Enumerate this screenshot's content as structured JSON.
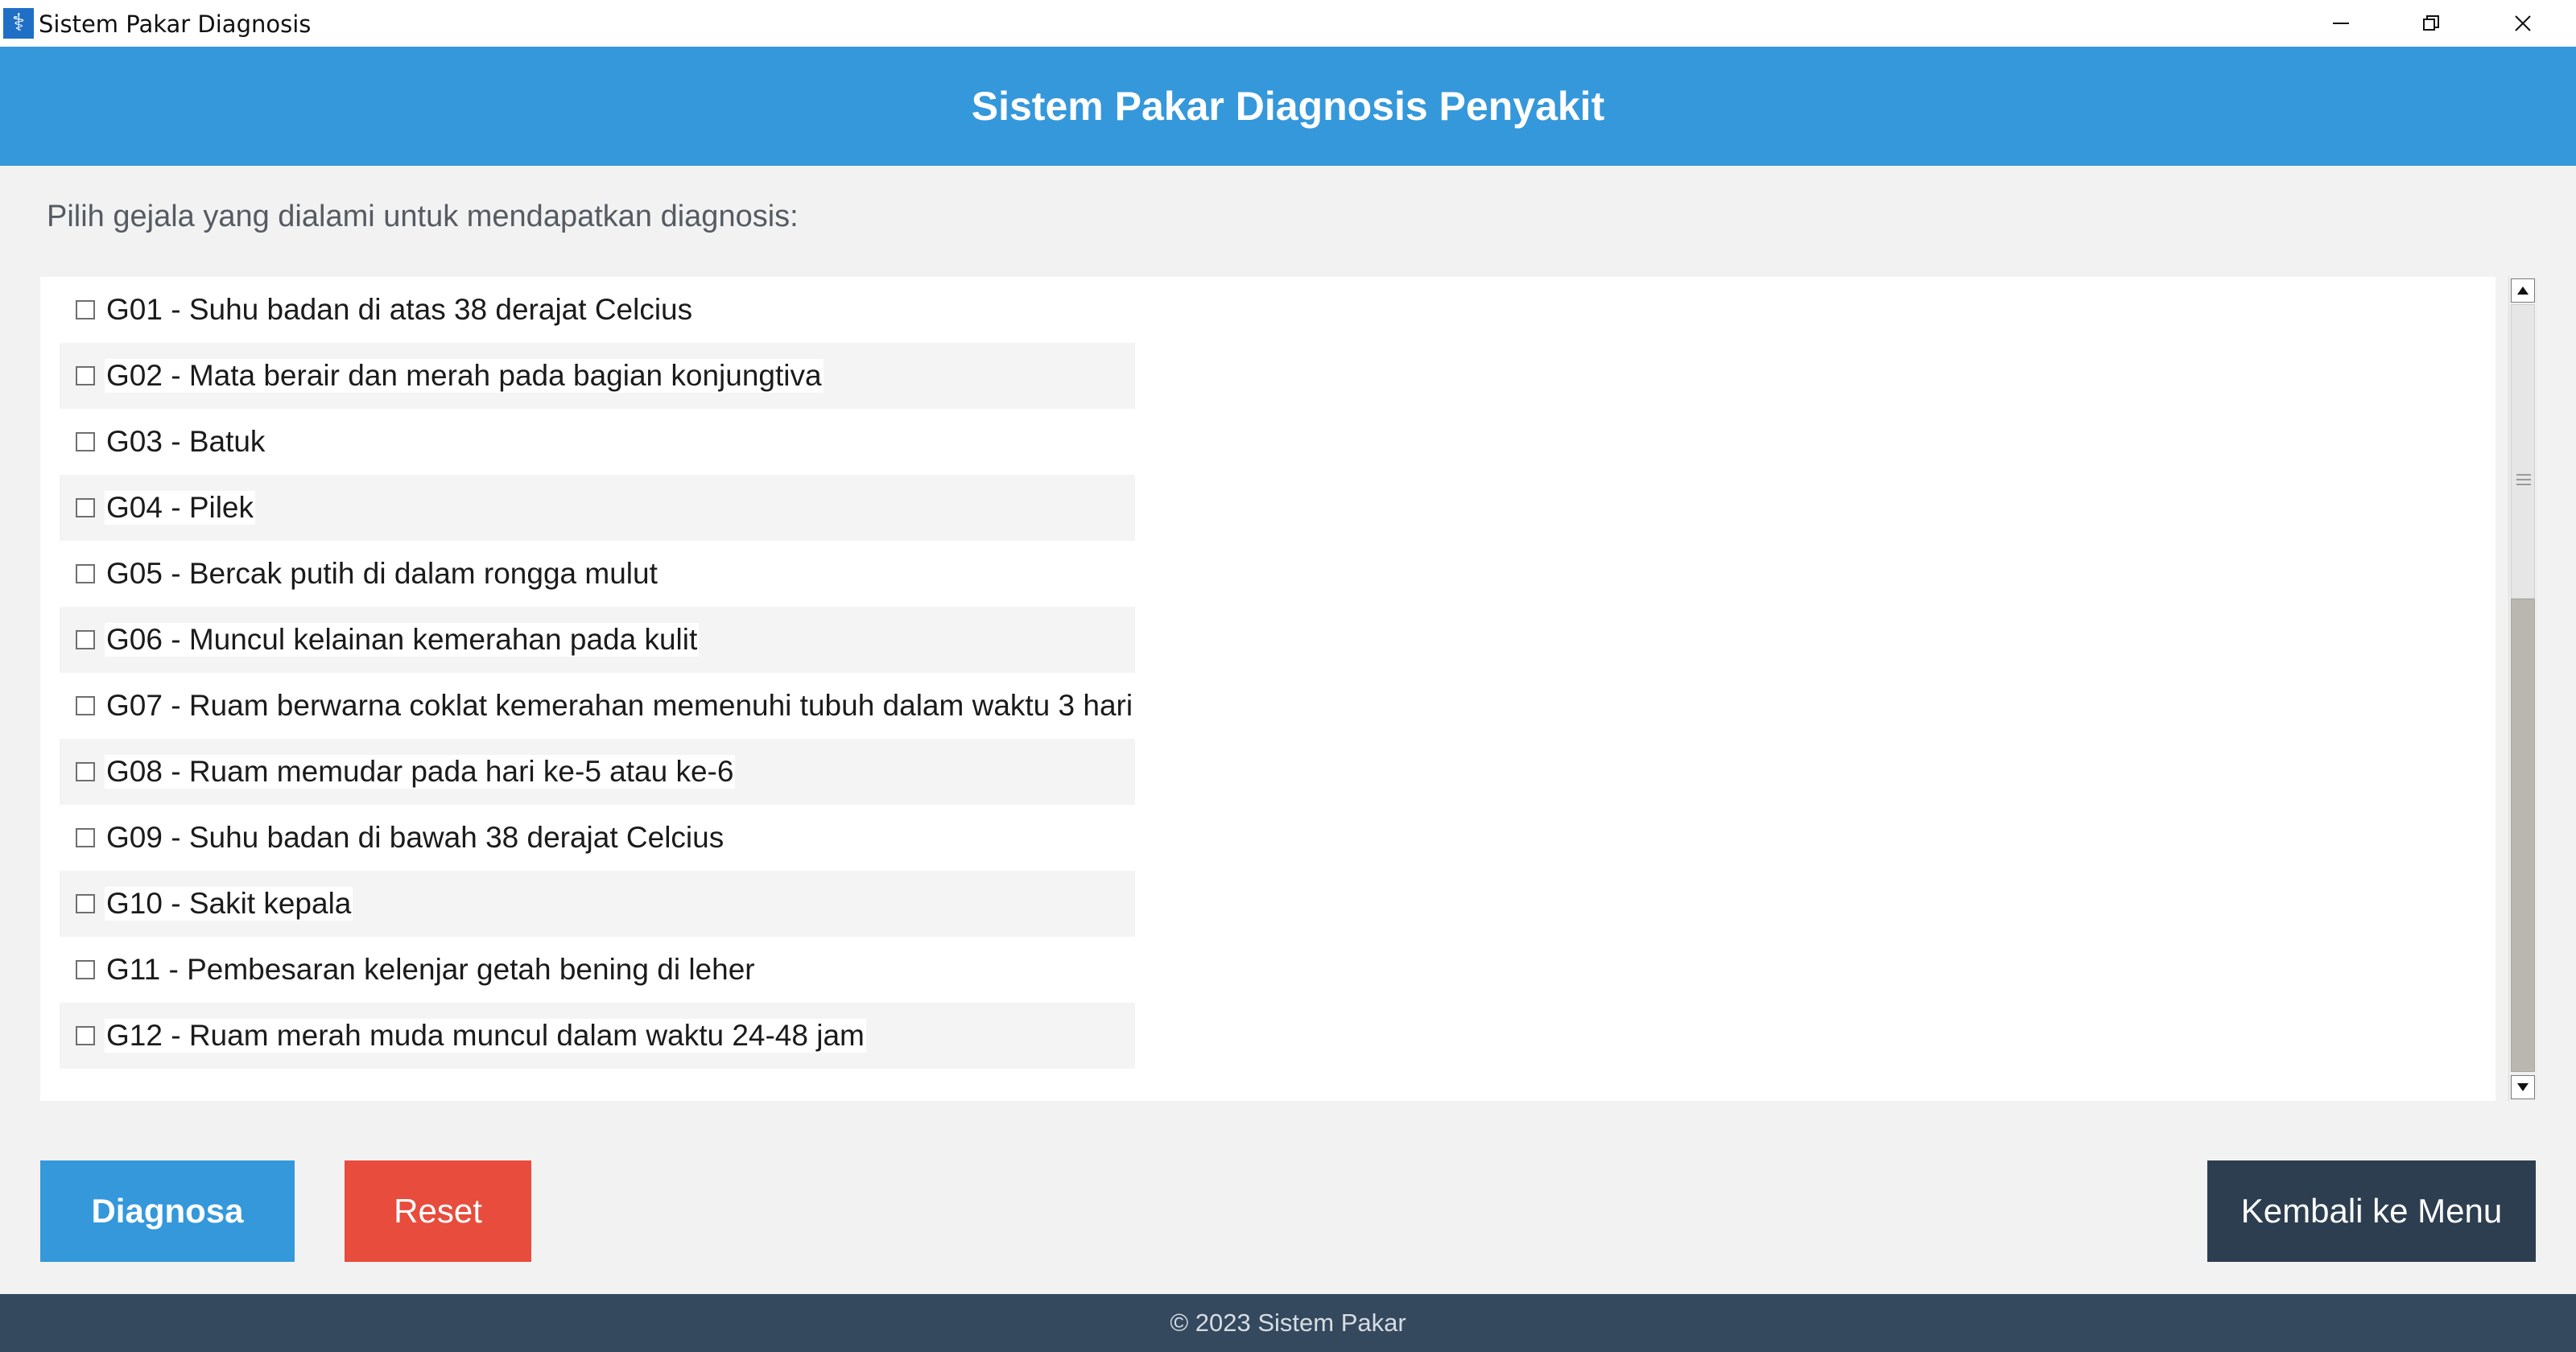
{
  "window": {
    "title": "Sistem Pakar Diagnosis",
    "controls": {
      "minimize": "—",
      "maximize": "❐",
      "close": "✕"
    }
  },
  "header": {
    "title": "Sistem Pakar Diagnosis Penyakit"
  },
  "main": {
    "instruction": "Pilih gejala yang dialami untuk mendapatkan diagnosis:",
    "symptoms": [
      {
        "label": "G01 - Suhu badan di atas 38 derajat Celcius",
        "checked": false
      },
      {
        "label": "G02 - Mata berair dan merah pada bagian konjungtiva",
        "checked": false
      },
      {
        "label": "G03 - Batuk",
        "checked": false
      },
      {
        "label": "G04 - Pilek",
        "checked": false
      },
      {
        "label": "G05 - Bercak putih di dalam rongga mulut",
        "checked": false
      },
      {
        "label": "G06 - Muncul kelainan kemerahan pada kulit",
        "checked": false
      },
      {
        "label": "G07 - Ruam berwarna coklat kemerahan memenuhi tubuh dalam waktu 3 hari",
        "checked": false
      },
      {
        "label": "G08 - Ruam memudar pada hari ke-5 atau ke-6",
        "checked": false
      },
      {
        "label": "G09 - Suhu badan di bawah 38 derajat Celcius",
        "checked": false
      },
      {
        "label": "G10 - Sakit kepala",
        "checked": false
      },
      {
        "label": "G11 - Pembesaran kelenjar getah bening di leher",
        "checked": false
      },
      {
        "label": "G12 - Ruam merah muda muncul dalam waktu 24-48 jam",
        "checked": false
      }
    ]
  },
  "actions": {
    "diagnose_label": "Diagnosa",
    "reset_label": "Reset",
    "back_label": "Kembali ke Menu"
  },
  "footer": {
    "text": "© 2023 Sistem Pakar"
  },
  "colors": {
    "primary": "#3498db",
    "danger": "#e74c3c",
    "dark": "#2c3e50",
    "footer": "#34495e",
    "background": "#f2f2f2"
  },
  "icons": {
    "app": "app-icon",
    "scroll_up": "scroll-up-arrow-icon",
    "scroll_down": "scroll-down-arrow-icon"
  }
}
